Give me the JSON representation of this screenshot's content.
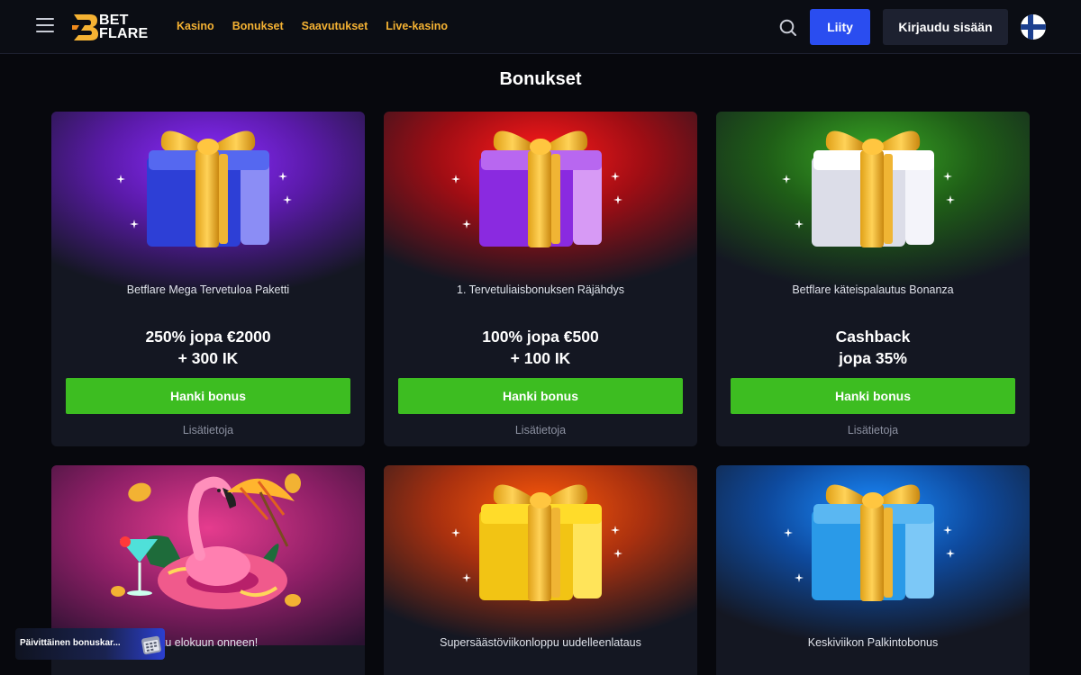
{
  "header": {
    "logo_line1": "BET",
    "logo_line2": "FLARE",
    "nav": [
      "Kasino",
      "Bonukset",
      "Saavutukset",
      "Live-kasino"
    ],
    "join_label": "Liity",
    "login_label": "Kirjaudu sisään",
    "accent_color": "#f5b233",
    "join_color": "#2a4df0"
  },
  "page": {
    "title": "Bonukset"
  },
  "bonuses": [
    {
      "title": "Betflare Mega Tervetuloa Paketti",
      "offer_line1": "250% jopa €2000",
      "offer_line2": "+ 300 IK",
      "button": "Hanki bonus",
      "more": "Lisätietoja",
      "theme": "purple",
      "icon": "gift-box-icon"
    },
    {
      "title": "1. Tervetuliaisbonuksen Räjähdys",
      "offer_line1": "100% jopa €500",
      "offer_line2": "+ 100 IK",
      "button": "Hanki bonus",
      "more": "Lisätietoja",
      "theme": "red",
      "icon": "gift-box-icon"
    },
    {
      "title": "Betflare käteispalautus Bonanza",
      "offer_line1": "Cashback",
      "offer_line2": "jopa 35%",
      "button": "Hanki bonus",
      "more": "Lisätietoja",
      "theme": "green",
      "icon": "gift-box-icon"
    },
    {
      "title": "rtu elokuun onneen!",
      "theme": "pink",
      "icon": "flamingo-float-icon"
    },
    {
      "title": "Supersäästöviikonloppu uudelleenlataus",
      "theme": "orange",
      "icon": "gift-box-icon"
    },
    {
      "title": "Keskiviikon Palkintobonus",
      "theme": "blue",
      "icon": "gift-box-icon"
    }
  ],
  "toast": {
    "label": "Päivittäinen bonuskar...",
    "icon": "calendar-icon"
  },
  "colors": {
    "button_green": "#3dbd21",
    "background": "#07080d",
    "card": "#141722"
  }
}
